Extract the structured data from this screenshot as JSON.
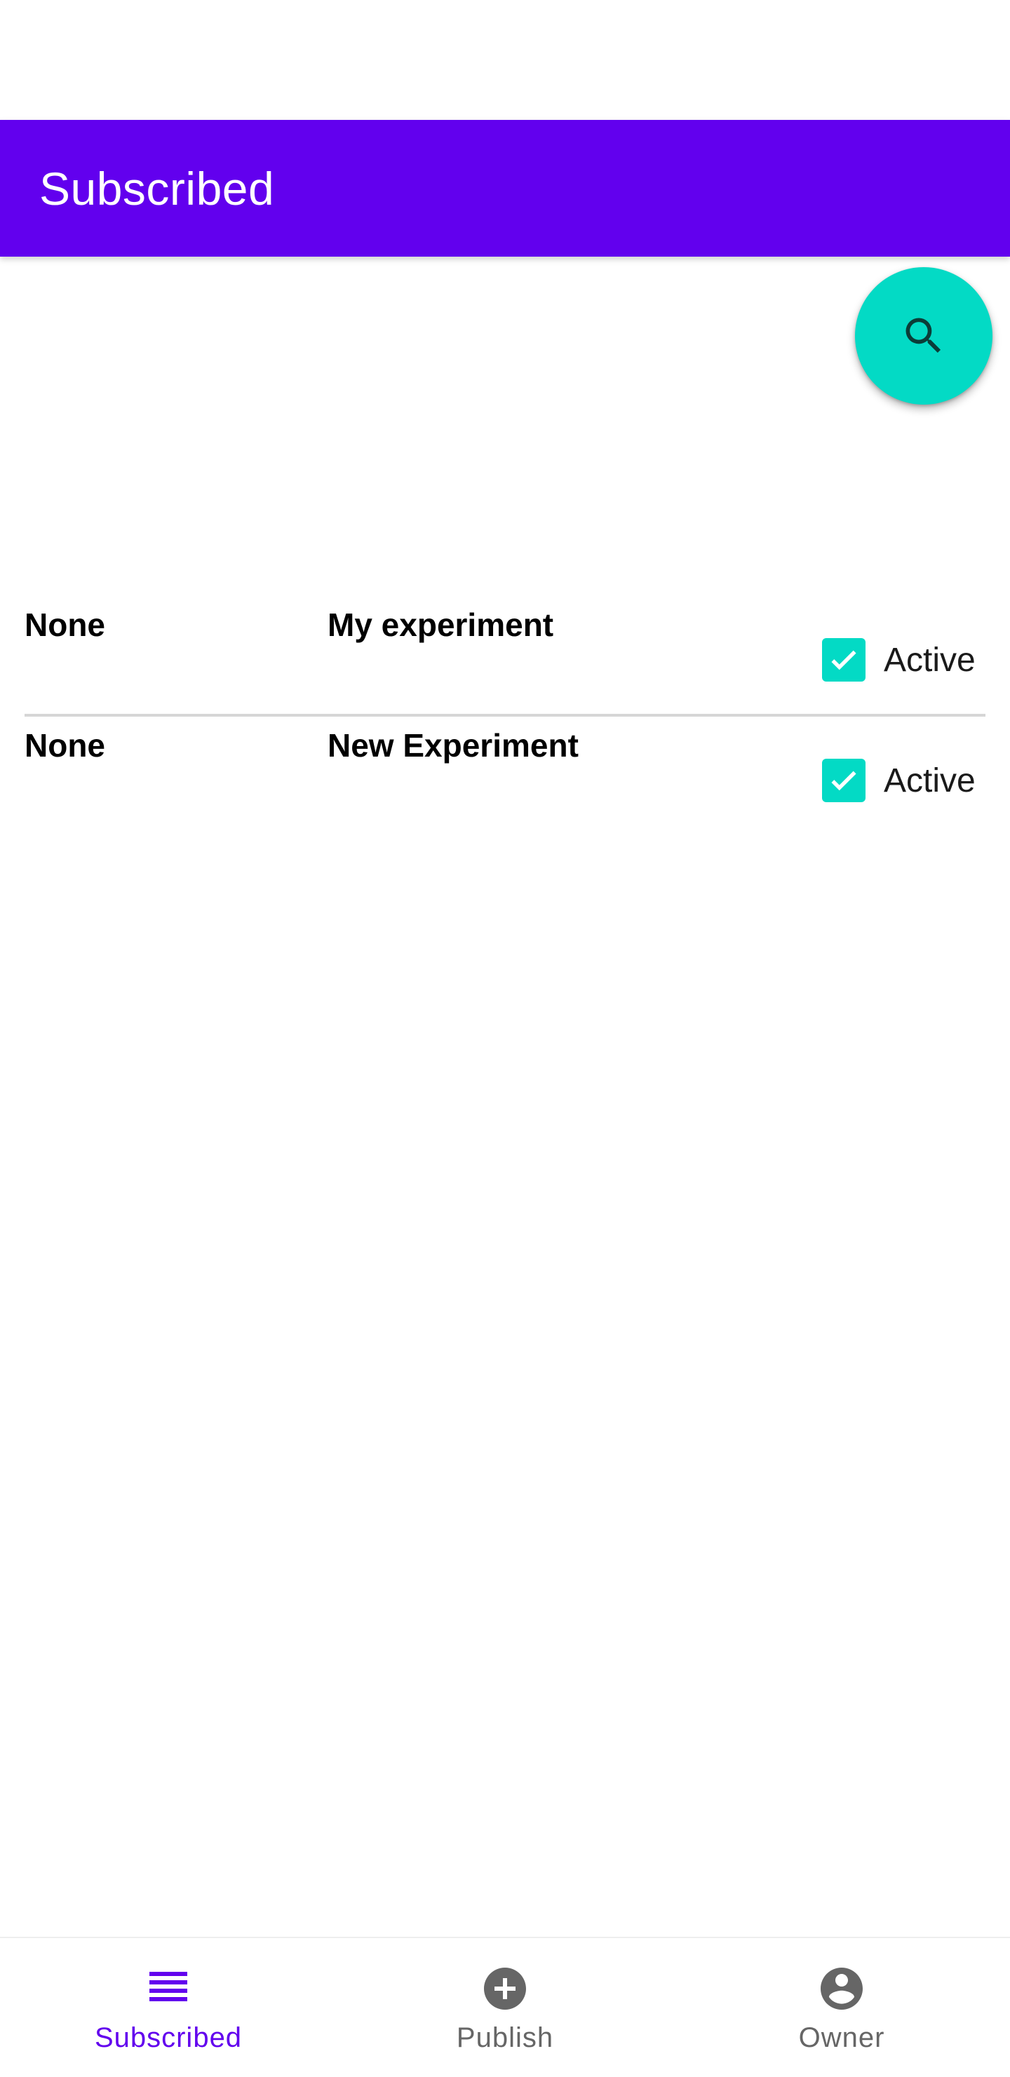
{
  "colors": {
    "primary": "#6200EE",
    "accent": "#03DAC5",
    "nav_inactive": "#666666",
    "text": "#000000"
  },
  "app_bar": {
    "title": "Subscribed"
  },
  "fab": {
    "icon": "search-icon"
  },
  "list": {
    "rows": [
      {
        "col_a": "None",
        "col_b": "My experiment",
        "checkbox_label": "Active",
        "checked": true
      },
      {
        "col_a": "None",
        "col_b": "New Experiment",
        "checkbox_label": "Active",
        "checked": true
      }
    ]
  },
  "bottom_nav": {
    "items": [
      {
        "label": "Subscribed",
        "icon": "list-icon",
        "active": true
      },
      {
        "label": "Publish",
        "icon": "add-circle-icon",
        "active": false
      },
      {
        "label": "Owner",
        "icon": "account-circle-icon",
        "active": false
      }
    ]
  }
}
